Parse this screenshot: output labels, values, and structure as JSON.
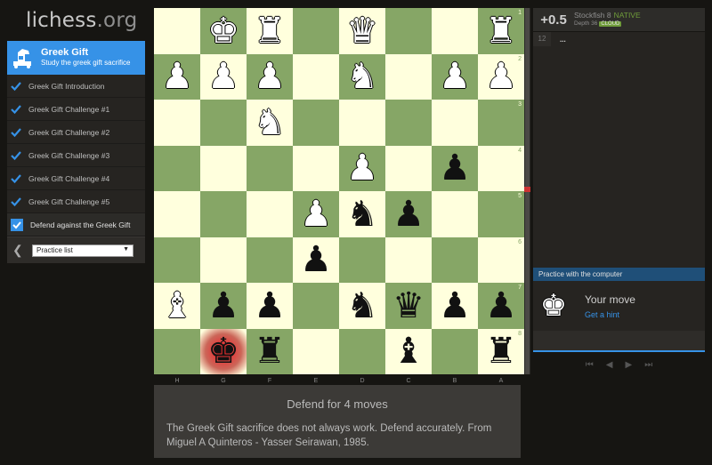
{
  "logo": {
    "name": "lichess",
    "tld": ".org"
  },
  "study": {
    "title": "Greek Gift",
    "subtitle": "Study the greek gift sacrifice",
    "chapters": [
      {
        "label": "Greek Gift Introduction",
        "done": true
      },
      {
        "label": "Greek Gift Challenge #1",
        "done": true
      },
      {
        "label": "Greek Gift Challenge #2",
        "done": true
      },
      {
        "label": "Greek Gift Challenge #3",
        "done": true
      },
      {
        "label": "Greek Gift Challenge #4",
        "done": true
      },
      {
        "label": "Greek Gift Challenge #5",
        "done": true
      },
      {
        "label": "Defend against the Greek Gift",
        "done": true,
        "selected": true
      }
    ],
    "prev_icon": "chevron-left-icon",
    "practice_select": "Practice list"
  },
  "board": {
    "ranks": [
      "1",
      "2",
      "3",
      "4",
      "5",
      "6",
      "7",
      "8"
    ],
    "files": [
      "H",
      "G",
      "F",
      "E",
      "D",
      "C",
      "B",
      "A"
    ],
    "pieces": [
      {
        "file": 1,
        "rank": 0,
        "type": "king",
        "color": "white"
      },
      {
        "file": 2,
        "rank": 0,
        "type": "rook",
        "color": "white"
      },
      {
        "file": 4,
        "rank": 0,
        "type": "queen",
        "color": "white"
      },
      {
        "file": 7,
        "rank": 0,
        "type": "rook",
        "color": "white"
      },
      {
        "file": 0,
        "rank": 1,
        "type": "pawn",
        "color": "white"
      },
      {
        "file": 1,
        "rank": 1,
        "type": "pawn",
        "color": "white"
      },
      {
        "file": 2,
        "rank": 1,
        "type": "pawn",
        "color": "white"
      },
      {
        "file": 4,
        "rank": 1,
        "type": "knight",
        "color": "white"
      },
      {
        "file": 6,
        "rank": 1,
        "type": "pawn",
        "color": "white"
      },
      {
        "file": 7,
        "rank": 1,
        "type": "pawn",
        "color": "white"
      },
      {
        "file": 2,
        "rank": 2,
        "type": "knight",
        "color": "white"
      },
      {
        "file": 4,
        "rank": 3,
        "type": "pawn",
        "color": "white"
      },
      {
        "file": 6,
        "rank": 3,
        "type": "pawn",
        "color": "black"
      },
      {
        "file": 3,
        "rank": 4,
        "type": "pawn",
        "color": "white"
      },
      {
        "file": 4,
        "rank": 4,
        "type": "knight",
        "color": "black"
      },
      {
        "file": 5,
        "rank": 4,
        "type": "pawn",
        "color": "black"
      },
      {
        "file": 3,
        "rank": 5,
        "type": "pawn",
        "color": "black"
      },
      {
        "file": 0,
        "rank": 6,
        "type": "bishop",
        "color": "white"
      },
      {
        "file": 1,
        "rank": 6,
        "type": "pawn",
        "color": "black"
      },
      {
        "file": 2,
        "rank": 6,
        "type": "pawn",
        "color": "black"
      },
      {
        "file": 4,
        "rank": 6,
        "type": "knight",
        "color": "black"
      },
      {
        "file": 5,
        "rank": 6,
        "type": "queen",
        "color": "black"
      },
      {
        "file": 6,
        "rank": 6,
        "type": "pawn",
        "color": "black"
      },
      {
        "file": 7,
        "rank": 6,
        "type": "pawn",
        "color": "black"
      },
      {
        "file": 1,
        "rank": 7,
        "type": "king",
        "color": "black",
        "in_check": true
      },
      {
        "file": 2,
        "rank": 7,
        "type": "rook",
        "color": "black"
      },
      {
        "file": 5,
        "rank": 7,
        "type": "bishop",
        "color": "black"
      },
      {
        "file": 7,
        "rank": 7,
        "type": "rook",
        "color": "black"
      }
    ],
    "colors": {
      "light": "#ffffdd",
      "dark": "#86a666",
      "check": "#e13a3a"
    }
  },
  "description": {
    "heading": "Defend for 4 moves",
    "text": "The Greek Gift sacrifice does not always work. Defend accurately. From Miguel A Quinteros - Yasser Seirawan, 1985."
  },
  "engine": {
    "eval": "+0.5",
    "name": "Stockfish 8",
    "native": "NATIVE",
    "depth": "Depth 36",
    "cloud": "CLOUD"
  },
  "moves": [
    {
      "num": "12",
      "move": "..."
    }
  ],
  "practice": {
    "header": "Practice with the computer",
    "your_move": "Your move",
    "hint": "Get a hint"
  },
  "controls": [
    "first-icon",
    "prev-icon",
    "next-icon",
    "last-icon"
  ],
  "accent": "#3692e7"
}
